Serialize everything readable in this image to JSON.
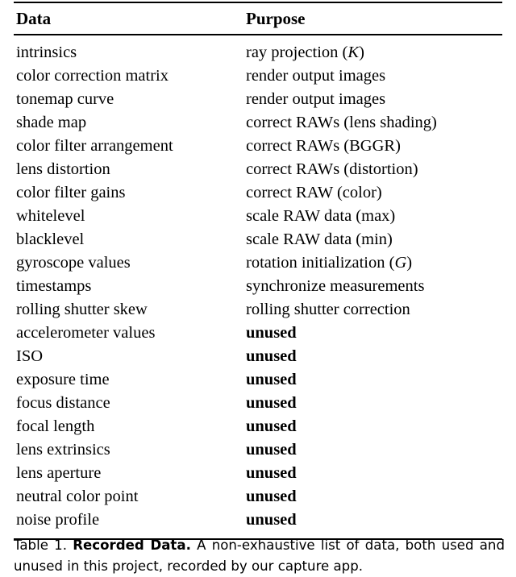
{
  "table": {
    "columns": [
      "Data",
      "Purpose"
    ],
    "rows": [
      {
        "data": "intrinsics",
        "purpose": "ray projection (",
        "purpose_var": "K",
        "purpose_tail": ")"
      },
      {
        "data": "color correction matrix",
        "purpose": "render output images"
      },
      {
        "data": "tonemap curve",
        "purpose": "render output images"
      },
      {
        "data": "shade map",
        "purpose": "correct RAWs (lens shading)"
      },
      {
        "data": "color filter arrangement",
        "purpose": "correct RAWs (BGGR)"
      },
      {
        "data": "lens distortion",
        "purpose": "correct RAWs (distortion)"
      },
      {
        "data": "color filter gains",
        "purpose": "correct RAW (color)"
      },
      {
        "data": "whitelevel",
        "purpose": "scale RAW data (max)"
      },
      {
        "data": "blacklevel",
        "purpose": "scale RAW data (min)"
      },
      {
        "data": "gyroscope values",
        "purpose": "rotation initialization (",
        "purpose_var": "G",
        "purpose_tail": ")"
      },
      {
        "data": "timestamps",
        "purpose": "synchronize measurements"
      },
      {
        "data": "rolling shutter skew",
        "purpose": "rolling shutter correction"
      },
      {
        "data": "accelerometer values",
        "purpose": "unused",
        "unused": true
      },
      {
        "data": "ISO",
        "purpose": "unused",
        "unused": true
      },
      {
        "data": "exposure time",
        "purpose": "unused",
        "unused": true
      },
      {
        "data": "focus distance",
        "purpose": "unused",
        "unused": true
      },
      {
        "data": "focal length",
        "purpose": "unused",
        "unused": true
      },
      {
        "data": "lens extrinsics",
        "purpose": "unused",
        "unused": true
      },
      {
        "data": "lens aperture",
        "purpose": "unused",
        "unused": true
      },
      {
        "data": "neutral color point",
        "purpose": "unused",
        "unused": true
      },
      {
        "data": "noise profile",
        "purpose": "unused",
        "unused": true
      }
    ]
  },
  "caption": {
    "label": "Table 1.",
    "title": "Recorded Data.",
    "body": "A non-exhaustive list of data, both used and unused in this project, recorded by our capture app."
  },
  "colors": {
    "text": "#000000",
    "background": "#ffffff",
    "rule": "#000000"
  }
}
